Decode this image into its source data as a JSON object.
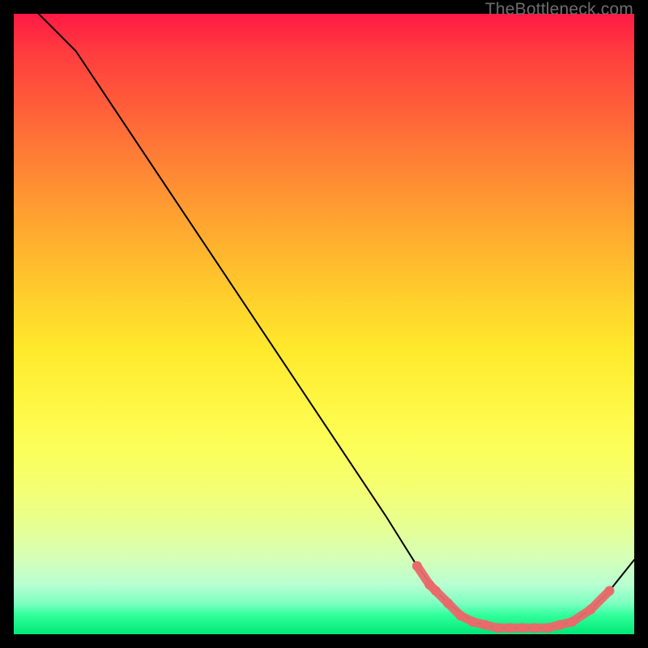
{
  "watermark": "TheBottleneck.com",
  "chart_data": {
    "type": "line",
    "title": "",
    "xlabel": "",
    "ylabel": "",
    "xlim": [
      0,
      100
    ],
    "ylim": [
      0,
      100
    ],
    "grid": false,
    "legend": false,
    "series": [
      {
        "name": "curve",
        "x": [
          0,
          6,
          10,
          20,
          30,
          40,
          50,
          60,
          65,
          68,
          70,
          74,
          78,
          82,
          86,
          90,
          93,
          96,
          100
        ],
        "y": [
          104,
          98,
          94,
          79,
          64,
          49,
          34,
          19,
          11,
          7,
          5,
          2,
          1,
          1,
          1,
          2,
          4,
          7,
          12
        ]
      }
    ],
    "markers": {
      "name": "highlight-dots",
      "color": "#e86a6a",
      "x": [
        65,
        67,
        68,
        70,
        72,
        74,
        76,
        78,
        80,
        82,
        84,
        86,
        88,
        90,
        93,
        96
      ],
      "y": [
        11,
        8,
        7,
        5,
        3,
        2,
        1.5,
        1,
        1,
        1,
        1,
        1,
        1.5,
        2,
        4,
        7
      ]
    }
  }
}
